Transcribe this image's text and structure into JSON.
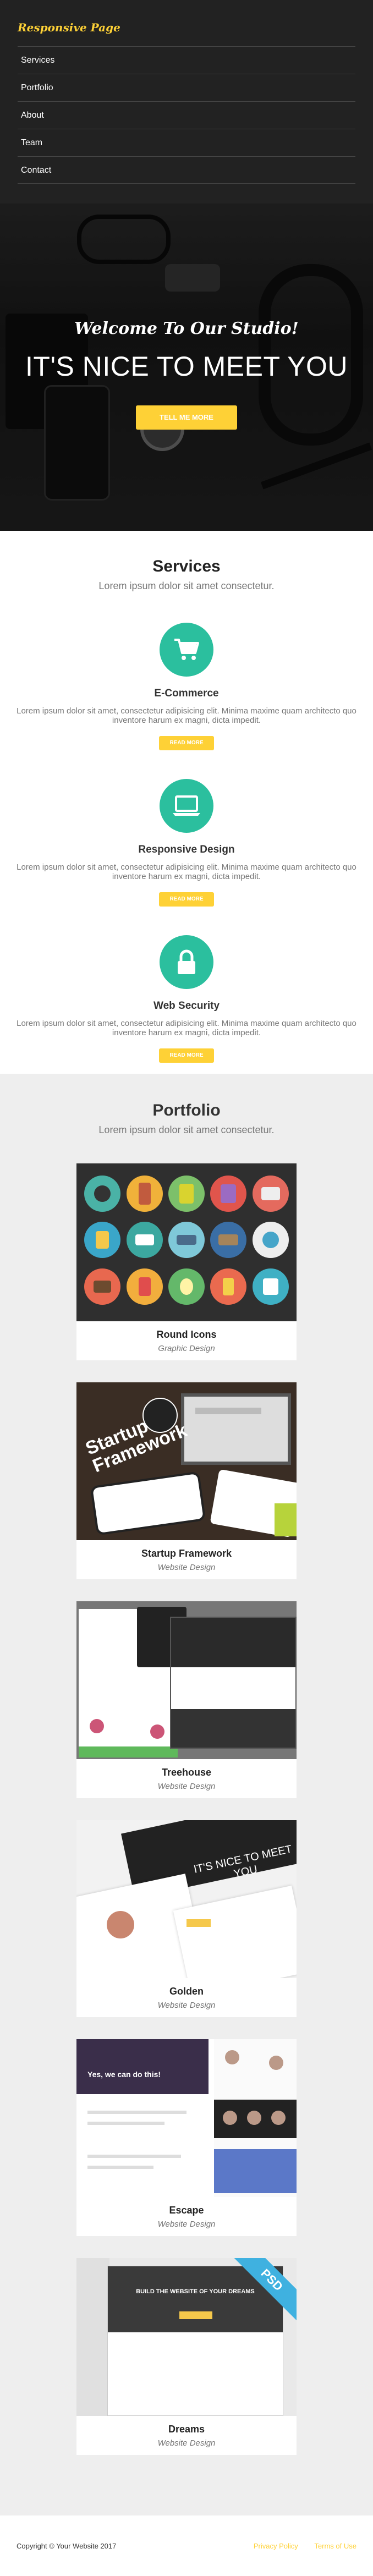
{
  "brand": "Responsive Page",
  "nav": {
    "items": [
      {
        "label": "Services"
      },
      {
        "label": "Portfolio"
      },
      {
        "label": "About"
      },
      {
        "label": "Team"
      },
      {
        "label": "Contact"
      }
    ]
  },
  "hero": {
    "lead": "Welcome To Our Studio!",
    "heading": "IT'S NICE TO MEET YOU",
    "button": "TELL ME MORE"
  },
  "services": {
    "title": "Services",
    "subtitle": "Lorem ipsum dolor sit amet consectetur.",
    "items": [
      {
        "icon": "shopping-cart-icon",
        "title": "E-Commerce",
        "text": "Lorem ipsum dolor sit amet, consectetur adipisicing elit. Minima maxime quam architecto quo inventore harum ex magni, dicta impedit.",
        "button": "READ MORE"
      },
      {
        "icon": "laptop-icon",
        "title": "Responsive Design",
        "text": "Lorem ipsum dolor sit amet, consectetur adipisicing elit. Minima maxime quam architecto quo inventore harum ex magni, dicta impedit.",
        "button": "READ MORE"
      },
      {
        "icon": "lock-icon",
        "title": "Web Security",
        "text": "Lorem ipsum dolor sit amet, consectetur adipisicing elit. Minima maxime quam architecto quo inventore harum ex magni, dicta impedit.",
        "button": "READ MORE"
      }
    ]
  },
  "portfolio": {
    "title": "Portfolio",
    "subtitle": "Lorem ipsum dolor sit amet consectetur.",
    "items": [
      {
        "name": "Round Icons",
        "category": "Graphic Design"
      },
      {
        "name": "Startup Framework",
        "category": "Website Design"
      },
      {
        "name": "Treehouse",
        "category": "Website Design"
      },
      {
        "name": "Golden",
        "category": "Website Design"
      },
      {
        "name": "Escape",
        "category": "Website Design"
      },
      {
        "name": "Dreams",
        "category": "Website Design"
      }
    ],
    "thumb_text": {
      "startup": "Startup\nFramework",
      "golden": "IT'S NICE TO MEET YOU",
      "escape": "Yes, we can do this!",
      "dreams": "BUILD THE WEBSITE OF YOUR DREAMS",
      "dreams_ribbon": "PSD"
    }
  },
  "footer": {
    "copyright": "Copyright © Your Website 2017",
    "links": [
      "Privacy Policy",
      "Terms of Use"
    ]
  },
  "colors": {
    "accent": "#fed136",
    "service_icon_bg": "#2bbf9e",
    "nav_bg": "#222222",
    "portfolio_bg": "#eeeeee"
  }
}
